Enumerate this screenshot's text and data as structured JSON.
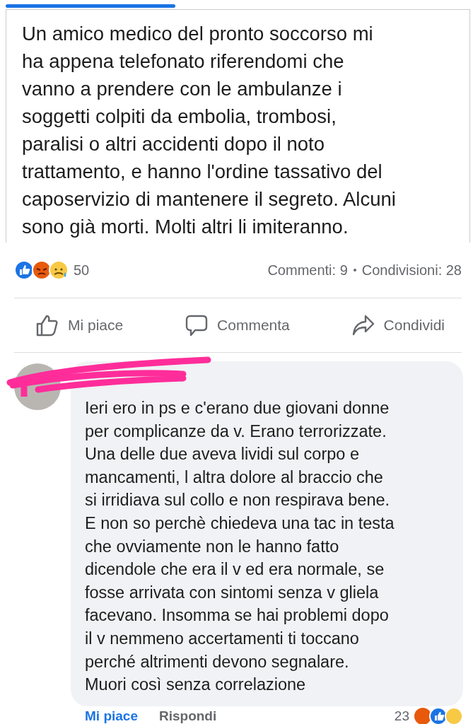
{
  "post": {
    "text_lines": [
      "Un amico medico del pronto soccorso mi",
      "ha appena telefonato riferendomi che",
      "vanno a prendere con le ambulanze i",
      "soggetti colpiti da embolia, trombosi,",
      "paralisi o altri accidenti dopo il noto",
      "trattamento, e hanno l'ordine tassativo del",
      "caposervizio di mantenere il segreto. Alcuni",
      "sono già morti. Molti altri li imiteranno."
    ]
  },
  "stats": {
    "reaction_count": "50",
    "comments": "Commenti: 9",
    "shares": "Condivisioni: 28"
  },
  "actions": [
    {
      "kind": "like",
      "label": "Mi piace"
    },
    {
      "kind": "comment",
      "label": "Commenta"
    },
    {
      "kind": "share",
      "label": "Condividi"
    }
  ],
  "comment": {
    "text_lines": [
      "Ieri ero in ps e c'erano due giovani donne",
      "per complicanze da v. Erano terrorizzate.",
      "Una delle due aveva lividi sul corpo e",
      "mancamenti, l altra dolore al braccio che",
      "si irridiava sul collo e non respirava bene.",
      "E non so perchè chiedeva una tac in testa",
      "che ovviamente non le hanno fatto",
      "dicendole che era il v ed era normale, se",
      "fosse arrivata con sintomi senza v gliela",
      "facevano. Insomma se hai problemi dopo",
      "il v nemmeno accertamenti ti toccano",
      "perché altrimenti devono segnalare.",
      "Muori così senza correlazione"
    ],
    "like_link": "Mi piace",
    "reply_link": "Rispondi",
    "reaction_count": "23"
  }
}
